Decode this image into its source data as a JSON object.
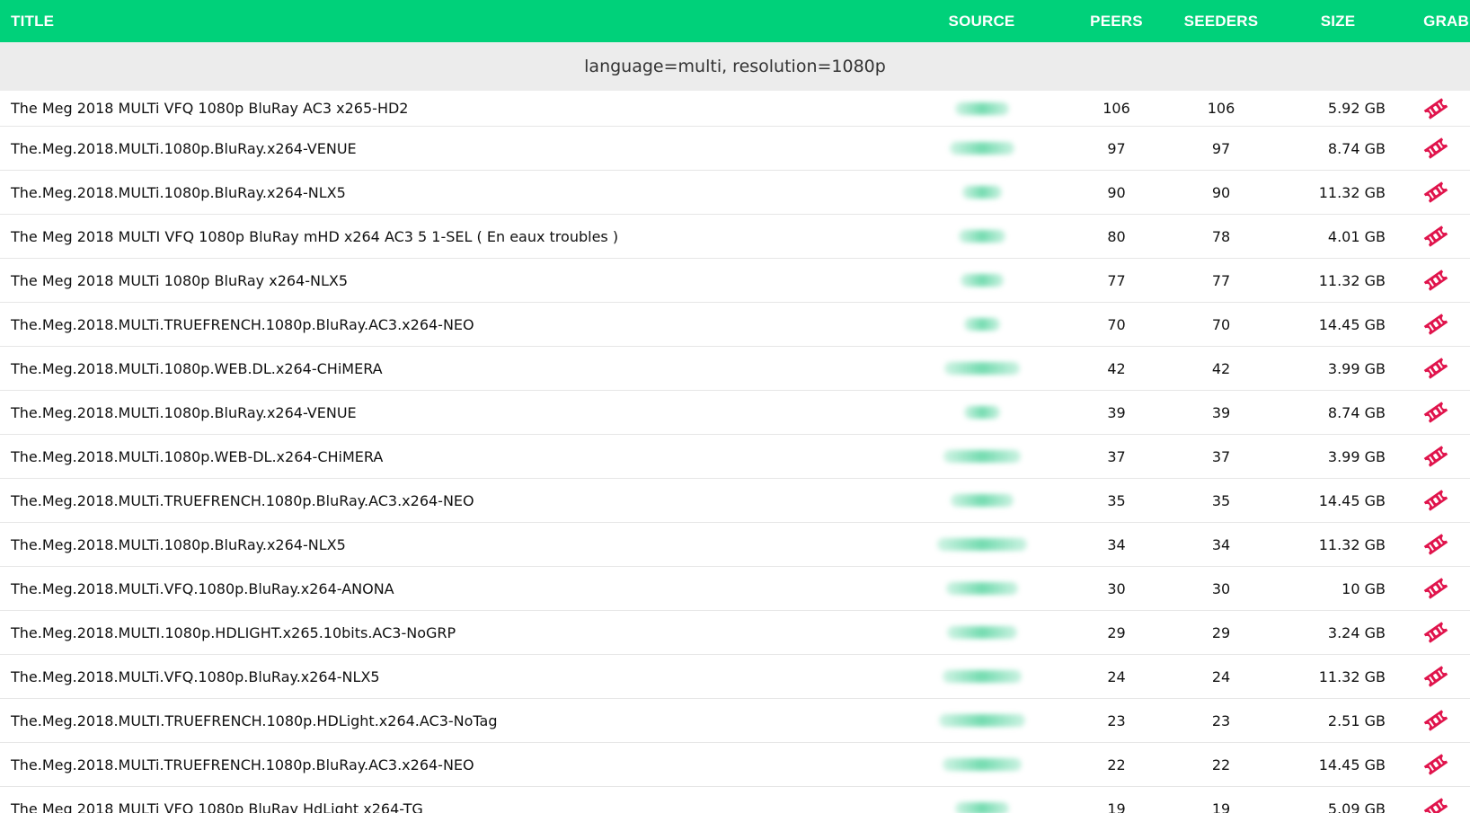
{
  "header": {
    "title": "TITLE",
    "source": "SOURCE",
    "peers": "PEERS",
    "seeders": "SEEDERS",
    "size": "SIZE",
    "grab": "GRAB"
  },
  "group": {
    "label": "language=multi, resolution=1080p"
  },
  "colors": {
    "header_bg": "#00d17a",
    "grab_icon": "#e0144c",
    "group_bg": "#ececec"
  },
  "icons": {
    "grab": "ticket-icon",
    "source": "blurred-source"
  },
  "rows": [
    {
      "title": "The Meg 2018 MULTi VFQ 1080p BluRay AC3 x265-HD2",
      "peers": "106",
      "seeders": "106",
      "size": "5.92 GB"
    },
    {
      "title": "The.Meg.2018.MULTi.1080p.BluRay.x264-VENUE",
      "peers": "97",
      "seeders": "97",
      "size": "8.74 GB"
    },
    {
      "title": "The.Meg.2018.MULTi.1080p.BluRay.x264-NLX5",
      "peers": "90",
      "seeders": "90",
      "size": "11.32 GB"
    },
    {
      "title": "The Meg 2018 MULTI VFQ 1080p BluRay mHD x264 AC3 5 1-SEL ( En eaux troubles )",
      "peers": "80",
      "seeders": "78",
      "size": "4.01 GB"
    },
    {
      "title": "The Meg 2018 MULTi 1080p BluRay x264-NLX5",
      "peers": "77",
      "seeders": "77",
      "size": "11.32 GB"
    },
    {
      "title": "The.Meg.2018.MULTi.TRUEFRENCH.1080p.BluRay.AC3.x264-NEO",
      "peers": "70",
      "seeders": "70",
      "size": "14.45 GB"
    },
    {
      "title": "The.Meg.2018.MULTi.1080p.WEB.DL.x264-CHiMERA",
      "peers": "42",
      "seeders": "42",
      "size": "3.99 GB"
    },
    {
      "title": "The.Meg.2018.MULTi.1080p.BluRay.x264-VENUE",
      "peers": "39",
      "seeders": "39",
      "size": "8.74 GB"
    },
    {
      "title": "The.Meg.2018.MULTi.1080p.WEB-DL.x264-CHiMERA",
      "peers": "37",
      "seeders": "37",
      "size": "3.99 GB"
    },
    {
      "title": "The.Meg.2018.MULTi.TRUEFRENCH.1080p.BluRay.AC3.x264-NEO",
      "peers": "35",
      "seeders": "35",
      "size": "14.45 GB"
    },
    {
      "title": "The.Meg.2018.MULTi.1080p.BluRay.x264-NLX5",
      "peers": "34",
      "seeders": "34",
      "size": "11.32 GB"
    },
    {
      "title": "The.Meg.2018.MULTi.VFQ.1080p.BluRay.x264-ANONA",
      "peers": "30",
      "seeders": "30",
      "size": "10 GB"
    },
    {
      "title": "The.Meg.2018.MULTI.1080p.HDLIGHT.x265.10bits.AC3-NoGRP",
      "peers": "29",
      "seeders": "29",
      "size": "3.24 GB"
    },
    {
      "title": "The.Meg.2018.MULTi.VFQ.1080p.BluRay.x264-NLX5",
      "peers": "24",
      "seeders": "24",
      "size": "11.32 GB"
    },
    {
      "title": "The.Meg.2018.MULTI.TRUEFRENCH.1080p.HDLight.x264.AC3-NoTag",
      "peers": "23",
      "seeders": "23",
      "size": "2.51 GB"
    },
    {
      "title": "The.Meg.2018.MULTi.TRUEFRENCH.1080p.BluRay.AC3.x264-NEO",
      "peers": "22",
      "seeders": "22",
      "size": "14.45 GB"
    },
    {
      "title": "The Meg 2018 MULTi VFQ 1080p BluRay HdLight x264-TG",
      "peers": "19",
      "seeders": "19",
      "size": "5.09 GB"
    }
  ]
}
